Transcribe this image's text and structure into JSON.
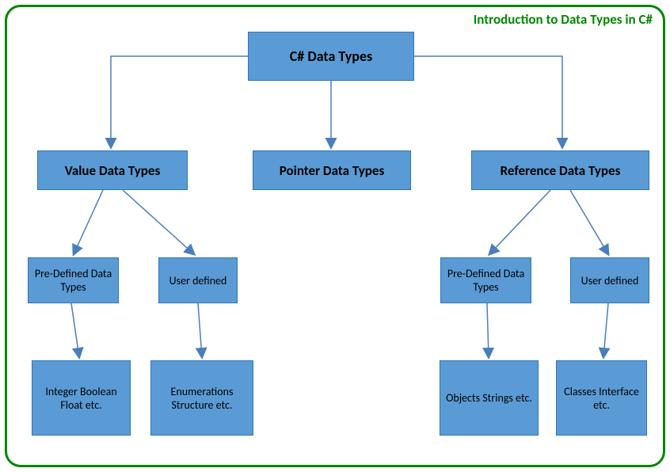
{
  "title": "Introduction to Data Types in C#",
  "root": "C# Data Types",
  "level1": {
    "value": "Value Data Types",
    "pointer": "Pointer Data Types",
    "reference": "Reference Data Types"
  },
  "value": {
    "predef": "Pre-Defined Data Types",
    "user": "User defined",
    "predef_examples": "Integer Boolean Float etc.",
    "user_examples": "Enumerations Structure etc."
  },
  "reference": {
    "predef": "Pre-Defined Data Types",
    "user": "User defined",
    "predef_examples": "Objects Strings etc.",
    "user_examples": "Classes Interface etc."
  },
  "chart_data": {
    "type": "tree",
    "title": "Introduction to Data Types in C#",
    "root": {
      "label": "C# Data Types",
      "children": [
        {
          "label": "Value Data Types",
          "children": [
            {
              "label": "Pre-Defined Data Types",
              "children": [
                {
                  "label": "Integer Boolean Float etc."
                }
              ]
            },
            {
              "label": "User defined",
              "children": [
                {
                  "label": "Enumerations Structure etc."
                }
              ]
            }
          ]
        },
        {
          "label": "Pointer Data Types",
          "children": []
        },
        {
          "label": "Reference Data Types",
          "children": [
            {
              "label": "Pre-Defined Data Types",
              "children": [
                {
                  "label": "Objects Strings etc."
                }
              ]
            },
            {
              "label": "User defined",
              "children": [
                {
                  "label": "Classes Interface etc."
                }
              ]
            }
          ]
        }
      ]
    }
  }
}
